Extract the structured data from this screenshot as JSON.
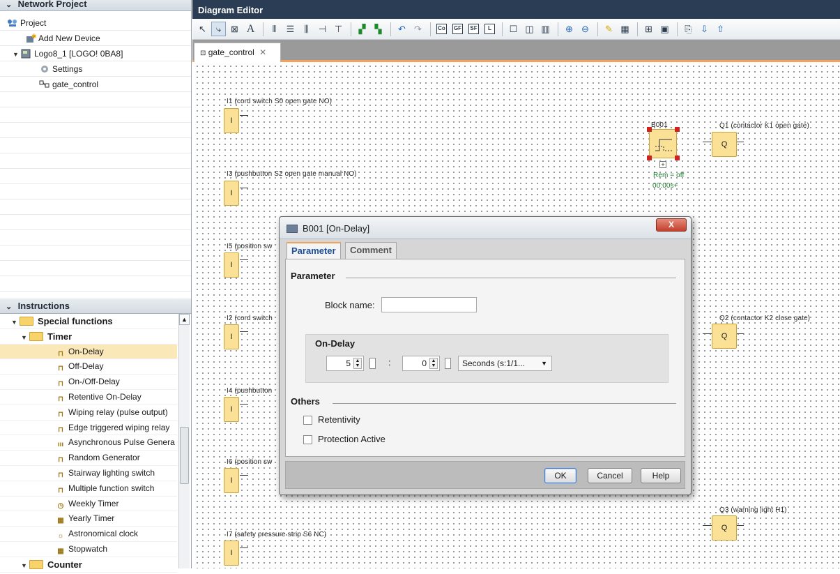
{
  "project_panel": {
    "title": "Network Project",
    "items": [
      {
        "label": "Project"
      },
      {
        "label": "Add New Device"
      },
      {
        "label": "Logo8_1 [LOGO! 0BA8]"
      },
      {
        "label": "Settings"
      },
      {
        "label": "gate_control"
      }
    ]
  },
  "instructions_panel": {
    "title": "Instructions",
    "items": [
      {
        "label": "Special functions",
        "icon": "folder-icon"
      },
      {
        "label": "Timer",
        "icon": "folder-icon"
      },
      {
        "label": "On-Delay",
        "icon": "on-delay-icon",
        "glyph": "⊓"
      },
      {
        "label": "Off-Delay",
        "icon": "off-delay-icon",
        "glyph": "⊓"
      },
      {
        "label": "On-/Off-Delay",
        "icon": "on-off-delay-icon",
        "glyph": "⊓"
      },
      {
        "label": "Retentive On-Delay",
        "icon": "retentive-on-delay-icon",
        "glyph": "⊓"
      },
      {
        "label": "Wiping relay (pulse output)",
        "icon": "wiping-relay-icon",
        "glyph": "⊓"
      },
      {
        "label": "Edge triggered wiping relay",
        "icon": "edge-wiping-relay-icon",
        "glyph": "⊓"
      },
      {
        "label": "Asynchronous Pulse Genera",
        "icon": "pulse-generator-icon",
        "glyph": "ııı"
      },
      {
        "label": "Random Generator",
        "icon": "random-generator-icon",
        "glyph": "⊓"
      },
      {
        "label": "Stairway lighting switch",
        "icon": "stairway-switch-icon",
        "glyph": "⊓"
      },
      {
        "label": "Multiple function switch",
        "icon": "multi-function-switch-icon",
        "glyph": "⊓"
      },
      {
        "label": "Weekly Timer",
        "icon": "clock-icon",
        "glyph": "◷"
      },
      {
        "label": "Yearly Timer",
        "icon": "calendar-icon",
        "glyph": "▦"
      },
      {
        "label": "Astronomical clock",
        "icon": "astronomical-clock-icon",
        "glyph": "☼"
      },
      {
        "label": "Stopwatch",
        "icon": "stopwatch-icon",
        "glyph": "▦"
      },
      {
        "label": "Counter",
        "icon": "folder-icon"
      }
    ]
  },
  "editor": {
    "title": "Diagram Editor",
    "tab_label": "gate_control",
    "toolbar": {
      "box_labels": [
        "Co",
        "GF",
        "SF",
        "L"
      ],
      "text_tool": "A"
    }
  },
  "diagram": {
    "inputs": [
      {
        "label": "I1 (cord switch S0 open gate NO)",
        "symbol": "I"
      },
      {
        "label": "I3 (pushbutton S2 open gate manual NO)",
        "symbol": "I"
      },
      {
        "label": "I5 (position sw",
        "symbol": "I"
      },
      {
        "label": "I2 (cord switch",
        "symbol": "I"
      },
      {
        "label": "I4 (pushbutton",
        "symbol": "I"
      },
      {
        "label": "I6 (position sw",
        "symbol": "I"
      },
      {
        "label": "I7 (safety pressure strip S6 NC)",
        "symbol": "I"
      }
    ],
    "outputs": [
      {
        "label": "Q1 (contactor K1 open gate)",
        "symbol": "Q"
      },
      {
        "label": "Q2 (contactor K2 close gate)",
        "symbol": "Q"
      },
      {
        "label": "Q3 (warning light H1)",
        "symbol": "Q"
      }
    ],
    "timer_block": {
      "name": "B001",
      "rem": "Rem = off",
      "time": "00:00s+",
      "expand": "+"
    }
  },
  "dialog": {
    "title": "B001 [On-Delay]",
    "close": "X",
    "tabs": [
      "Parameter",
      "Comment"
    ],
    "parameter_group": "Parameter",
    "block_name_label": "Block name:",
    "block_name_value": "",
    "ondelay_group": "On-Delay",
    "time_value_1": "5",
    "time_value_2": "0",
    "separator": ":",
    "units": "Seconds (s:1/1...",
    "others_group": "Others",
    "checkbox_retentivity": "Retentivity",
    "checkbox_protection": "Protection Active",
    "buttons": {
      "ok": "OK",
      "cancel": "Cancel",
      "help": "Help"
    }
  }
}
